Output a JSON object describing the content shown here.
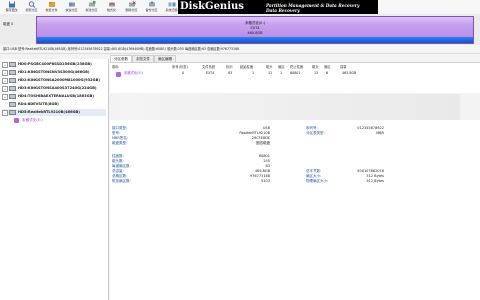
{
  "toolbar": {
    "buttons": [
      {
        "label": "保存更改",
        "icon": "save-icon"
      },
      {
        "label": "搜索分区",
        "icon": "search-icon"
      },
      {
        "label": "恢复文件",
        "icon": "recover-icon"
      },
      {
        "label": "快速分区",
        "icon": "quick-partition-icon"
      },
      {
        "label": "新建分区",
        "icon": "new-partition-icon"
      },
      {
        "label": "格式化",
        "icon": "format-icon"
      },
      {
        "label": "删除分区",
        "icon": "delete-icon"
      },
      {
        "label": "备份分区",
        "icon": "backup-icon"
      },
      {
        "label": "系统迁移",
        "icon": "migrate-icon"
      }
    ]
  },
  "banner": {
    "logo": "DiskGenius",
    "tagline1": "Partition Management & Data Recovery",
    "tagline2": "Data Recovery"
  },
  "disk_map": {
    "disk_label": "磁盘 0",
    "partition_name": "未格式化(E:)",
    "fs": "EXT4",
    "size": "465.8GB"
  },
  "infobar": {
    "text": "接口:USB  型号:RealtekRTL9210B(465GB)  序列号:012345678922  容量:465.8GB(476940MB)  柱面数:60801  磁头数:255  每道扇区数:63  总扇区数:976773168"
  },
  "tree": {
    "disks": [
      "HD0:PSGBC400P8SSD256GB(238GB)",
      "HD1:KINGSTONSNV3S500G(466GB)",
      "HD2:KINGSTONSA2000M81000G(932GB)",
      "HD3:KINGSTONSA400S37240G(224GB)",
      "HD4:TOSHIBAEXTERNALUSB(1863GB)",
      "RD4:8DEVSITE(8GB)",
      "HD5:RealtekRTL9210B(466GB)"
    ],
    "partition": "未格式化(E:)"
  },
  "tabs": [
    "分区参数",
    "浏览文件",
    "扇区编辑"
  ],
  "partition_table": {
    "columns": [
      "卷标",
      "序号(状态)",
      "文件系统",
      "标识",
      "起始柱面",
      "磁头",
      "扇区",
      "终止柱面",
      "磁头",
      "扇区",
      "容量"
    ],
    "row": [
      "未格式化(E:)",
      "0",
      "EXT4",
      "83",
      "1",
      "12",
      "1",
      "60801",
      "13",
      "6",
      "465.8GB"
    ]
  },
  "properties": {
    "interface_label": "接口类型:",
    "interface_value": "USB",
    "serial_label": "序列号:",
    "serial_value": "012345678922",
    "model_label": "型号:",
    "model_value": "RealtekRTL9210B",
    "table_type_label": "分区表类型:",
    "table_type_value": "MBR",
    "mbr_sig_label": "MBR签名:",
    "mbr_sig_value": "29CFE8DE",
    "disk_type_label": "磁盘类型:",
    "disk_type_value": "固态磁盘",
    "cylinders_label": "柱面数:",
    "cylinders_value": "60801",
    "heads_label": "磁头数:",
    "heads_value": "255",
    "spt_label": "每道扇区数:",
    "spt_value": "63",
    "capacity_label": "总容量:",
    "capacity_value": "465.8GB",
    "bytes_label": "总字节数:",
    "bytes_value": "500107862016",
    "total_sectors_label": "总扇区数:",
    "total_sectors_value": "976773168",
    "sector_size_label": "扇区大小:",
    "sector_size_value": "512 Bytes",
    "extra_sectors_label": "附加扇区数:",
    "extra_sectors_value": "5103",
    "phys_sector_label": "物理扇区大小:",
    "phys_sector_value": "512 Bytes"
  },
  "colors": {
    "partition_fill": "#b184e6",
    "partition_bottom": "#1456c8",
    "label_blue": "#1a4f9c"
  }
}
